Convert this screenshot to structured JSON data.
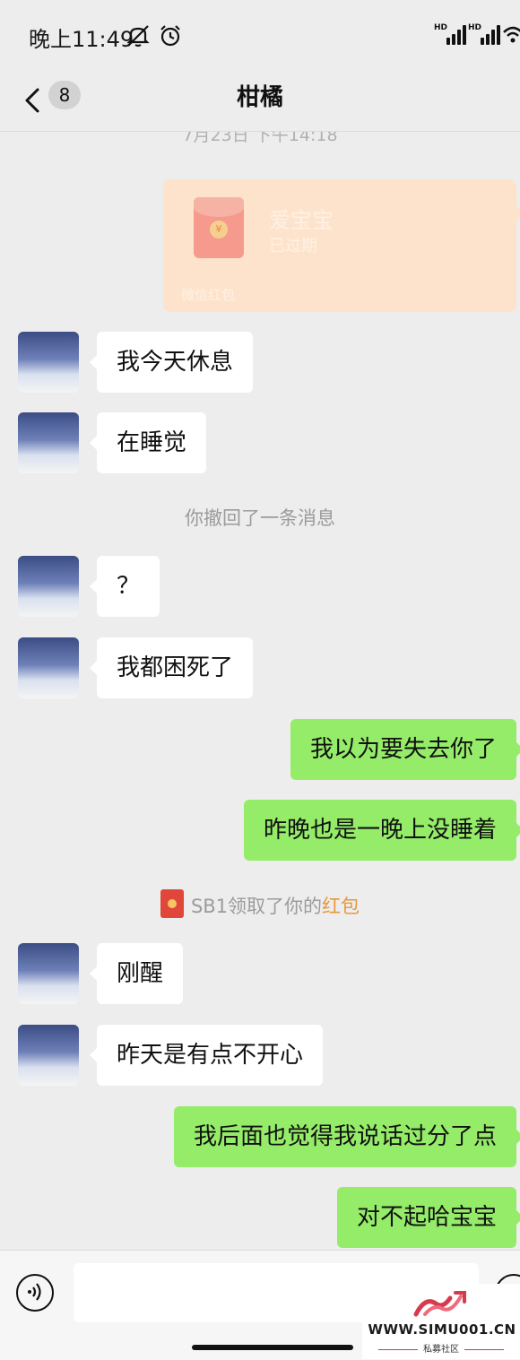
{
  "status_bar": {
    "time": "晚上11:49",
    "icons": [
      "mute-icon",
      "alarm-icon",
      "hd-signal-icon",
      "hd-signal-icon",
      "wifi-icon"
    ],
    "network_labels": [
      "HD",
      "HD"
    ]
  },
  "header": {
    "unread_count": "8",
    "title": "柑橘"
  },
  "chat": {
    "timestamp": "7月23日 下午14:18",
    "red_packet": {
      "title": "爱宝宝",
      "status": "已过期",
      "label": "微信红包",
      "color": "#fde3cb"
    },
    "messages": [
      {
        "side": "in",
        "text": "我今天休息"
      },
      {
        "side": "in",
        "text": "在睡觉"
      },
      {
        "side": "in",
        "text": "？"
      },
      {
        "side": "in",
        "text": "我都困死了"
      },
      {
        "side": "out",
        "text": "我以为要失去你了"
      },
      {
        "side": "out",
        "text": "昨晚也是一晚上没睡着"
      },
      {
        "side": "in",
        "text": "刚醒"
      },
      {
        "side": "in",
        "text": "昨天是有点不开心"
      },
      {
        "side": "out",
        "text": "我后面也觉得我说话过分了点"
      },
      {
        "side": "out",
        "text": "对不起哈宝宝"
      }
    ],
    "recall_notice": "你撤回了一条消息",
    "claim_notice": {
      "prefix": "SB1领取了你的",
      "link": "红包"
    }
  },
  "input_bar": {
    "value": "",
    "placeholder": ""
  },
  "watermark": {
    "url": "WWW.SIMU001.CN",
    "subtitle": "私募社区"
  },
  "colors": {
    "outgoing_bubble": "#95ec69",
    "incoming_bubble": "#ffffff",
    "background": "#ededed",
    "link": "#e8973d"
  }
}
